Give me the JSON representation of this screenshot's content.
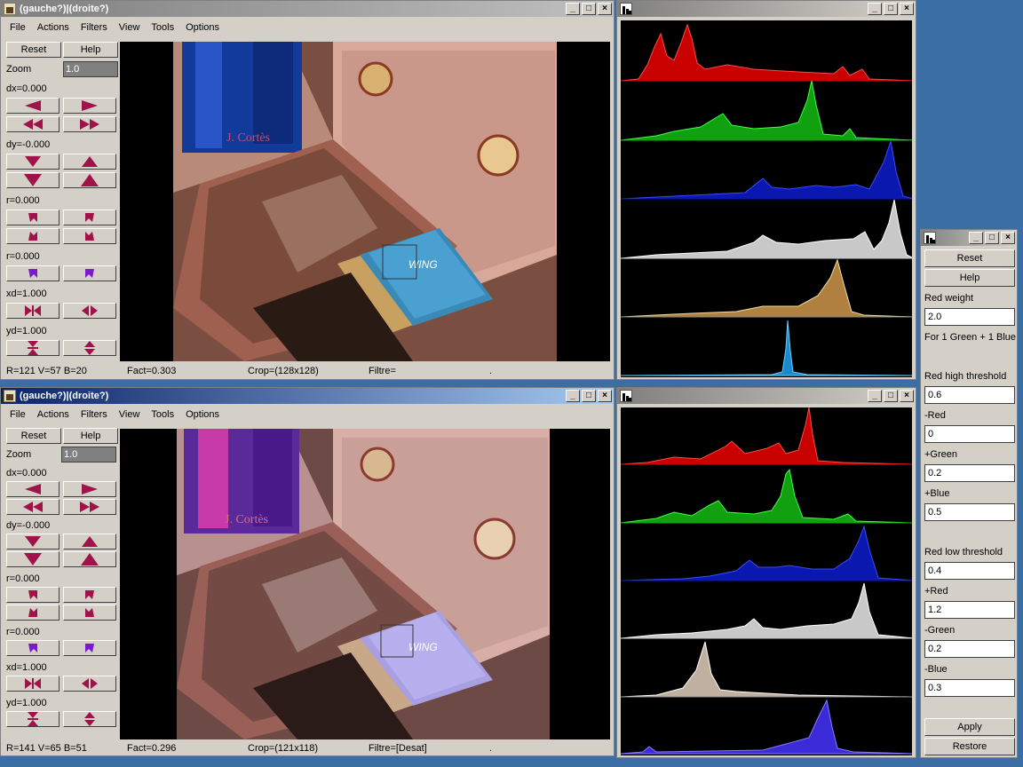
{
  "top_window": {
    "title": "(gauche?)|(droite?)",
    "menu": [
      "File",
      "Actions",
      "Filters",
      "View",
      "Tools",
      "Options"
    ],
    "reset_label": "Reset",
    "help_label": "Help",
    "zoom_label": "Zoom",
    "zoom_value": "1.0",
    "dx_label": "dx=0.000",
    "dy_label": "dy=-0.000",
    "r1_label": "r=0.000",
    "r2_label": "r=0.000",
    "xd_label": "xd=1.000",
    "yd_label": "yd=1.000",
    "status": {
      "rgb": "R=121 V=57 B=20",
      "fact": "Fact=0.303",
      "crop": "Crop=(128x128)",
      "filter": "Filtre=",
      "dot": "."
    },
    "photo_text": {
      "brand": "J. Cortès",
      "tin": "WING"
    }
  },
  "bottom_window": {
    "title": "(gauche?)|(droite?)",
    "menu": [
      "File",
      "Actions",
      "Filters",
      "View",
      "Tools",
      "Options"
    ],
    "reset_label": "Reset",
    "help_label": "Help",
    "zoom_label": "Zoom",
    "zoom_value": "1.0",
    "dx_label": "dx=0.000",
    "dy_label": "dy=-0.000",
    "r1_label": "r=0.000",
    "r2_label": "r=0.000",
    "xd_label": "xd=1.000",
    "yd_label": "yd=1.000",
    "status": {
      "rgb": "R=141 V=65 B=51",
      "fact": "Fact=0.296",
      "crop": "Crop=(121x118)",
      "filter": "Filtre=[Desat]",
      "dot": "."
    },
    "photo_text": {
      "brand": "J. Cortès",
      "tin": "WING"
    }
  },
  "params_panel": {
    "reset_label": "Reset",
    "help_label": "Help",
    "red_weight_label": "Red weight",
    "red_weight_value": "2.0",
    "note": "For 1 Green + 1 Blue",
    "red_high_label": "Red high threshold",
    "red_high_value": "0.6",
    "minus_red_label": "-Red",
    "minus_red_value": "0",
    "plus_green_label": "+Green",
    "plus_green_value": "0.2",
    "plus_blue_label": "+Blue",
    "plus_blue_value": "0.5",
    "red_low_label": "Red low threshold",
    "red_low_value": "0.4",
    "plus_red_label": "+Red",
    "plus_red_value": "1.2",
    "minus_green_label": "-Green",
    "minus_green_value": "0.2",
    "minus_blue_label": "-Blue",
    "minus_blue_value": "0.3",
    "apply_label": "Apply",
    "restore_label": "Restore"
  },
  "colors": {
    "active_title": "#0a246a",
    "inactive_title": "#7f7f7f",
    "button_face": "#d4d0c8",
    "arrow": "#a0124a",
    "desktop": "#3a6ea5"
  },
  "icons": {
    "app": "app-icon",
    "histogram": "histogram-icon",
    "minimize": "minimize-icon",
    "maximize": "maximize-icon",
    "close": "close-icon"
  }
}
